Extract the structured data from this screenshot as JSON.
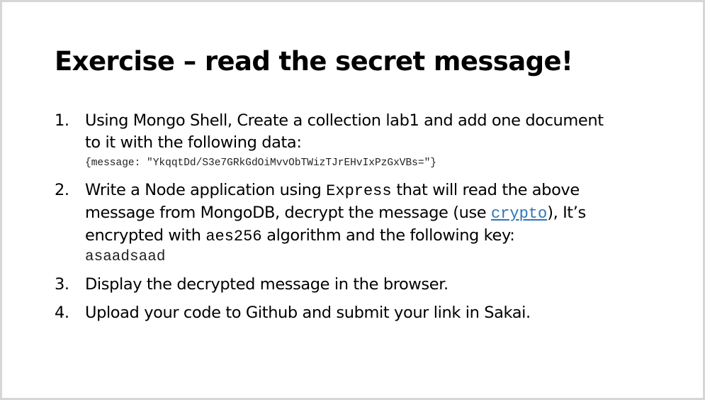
{
  "slide": {
    "title": "Exercise – read the secret message!"
  },
  "items": [
    {
      "number": "1.",
      "line1": "Using Mongo Shell, Create a collection lab1 and add one document",
      "line2": "to it with the following data:",
      "code": "{message: \"YkqqtDd/S3e7GRkGdOiMvvObTWizTJrEHvIxPzGxVBs=\"}"
    },
    {
      "number": "2.",
      "line1_pre": "Write a Node application using ",
      "line1_code": "Express",
      "line1_post": " that will read the above",
      "line2_pre": "message from MongoDB, decrypt the message (use ",
      "line2_link": "crypto",
      "line2_post": "),  It’s",
      "line3_pre": "encrypted with ",
      "line3_code": "aes256",
      "line3_post": " algorithm and the following key:",
      "key": "asaadsaad"
    },
    {
      "number": "3.",
      "text": "Display the decrypted message in the browser."
    },
    {
      "number": "4.",
      "text": "Upload your code to Github and submit your link in Sakai."
    }
  ],
  "colors": {
    "link": "#2e75b6",
    "border": "#d6d6d6"
  }
}
